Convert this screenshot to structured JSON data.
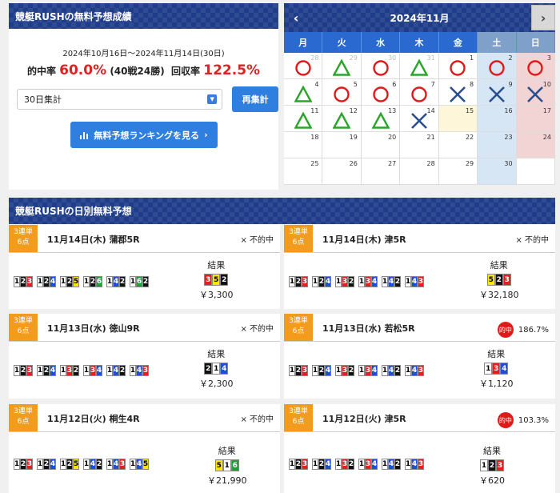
{
  "performance": {
    "title": "競艇RUSHの無料予想成績",
    "period": "2024年10月16日～2024年11月14日(30日)",
    "hit_label": "的中率",
    "hit_rate": "60.0%",
    "record": "(40戦24勝)",
    "return_label": "回収率",
    "return_rate": "122.5%",
    "select_value": "30日集計",
    "recalc_button": "再集計",
    "ranking_button": "無料予想ランキングを見る"
  },
  "calendar": {
    "month_title": "2024年11月",
    "prev": "‹",
    "next": "›",
    "weekdays": [
      "月",
      "火",
      "水",
      "木",
      "金",
      "土",
      "日"
    ],
    "days": [
      {
        "d": "28",
        "m": "circle",
        "other": true
      },
      {
        "d": "29",
        "m": "triangle",
        "other": true
      },
      {
        "d": "30",
        "m": "circle",
        "other": true
      },
      {
        "d": "31",
        "m": "triangle",
        "other": true
      },
      {
        "d": "1",
        "m": "circle"
      },
      {
        "d": "2",
        "m": "circle"
      },
      {
        "d": "3",
        "m": "circle"
      },
      {
        "d": "4",
        "m": "triangle"
      },
      {
        "d": "5",
        "m": "circle"
      },
      {
        "d": "6",
        "m": "circle"
      },
      {
        "d": "7",
        "m": "circle"
      },
      {
        "d": "8",
        "m": "cross"
      },
      {
        "d": "9",
        "m": "cross"
      },
      {
        "d": "10",
        "m": "cross"
      },
      {
        "d": "11",
        "m": "triangle"
      },
      {
        "d": "12",
        "m": "triangle"
      },
      {
        "d": "13",
        "m": "triangle"
      },
      {
        "d": "14",
        "m": "cross"
      },
      {
        "d": "15",
        "m": ""
      },
      {
        "d": "16",
        "m": ""
      },
      {
        "d": "17",
        "m": ""
      },
      {
        "d": "18",
        "m": ""
      },
      {
        "d": "19",
        "m": ""
      },
      {
        "d": "20",
        "m": ""
      },
      {
        "d": "21",
        "m": ""
      },
      {
        "d": "22",
        "m": ""
      },
      {
        "d": "23",
        "m": ""
      },
      {
        "d": "24",
        "m": ""
      },
      {
        "d": "25",
        "m": ""
      },
      {
        "d": "26",
        "m": ""
      },
      {
        "d": "27",
        "m": ""
      },
      {
        "d": "28",
        "m": ""
      },
      {
        "d": "29",
        "m": ""
      },
      {
        "d": "30",
        "m": ""
      },
      {
        "d": "",
        "m": ""
      }
    ]
  },
  "daily": {
    "title": "競艇RUSHの日別無料予想",
    "tag_line1": "3連単",
    "tag_line2": "6点",
    "result_label": "結果",
    "cards": [
      {
        "title": "11月14日(木) 蒲郡5R",
        "badge": "",
        "status": "× 不的中",
        "bets": [
          "123",
          "124",
          "125",
          "126",
          "142",
          "162"
        ],
        "result": "352",
        "payout": "￥3,300"
      },
      {
        "title": "11月14日(木) 津5R",
        "badge": "",
        "status": "× 不的中",
        "bets": [
          "123",
          "124",
          "132",
          "134",
          "142",
          "143"
        ],
        "result": "523",
        "payout": "￥32,180"
      },
      {
        "title": "11月13日(水) 徳山9R",
        "badge": "",
        "status": "× 不的中",
        "bets": [
          "123",
          "124",
          "132",
          "134",
          "142",
          "143"
        ],
        "result": "214",
        "payout": "￥2,300"
      },
      {
        "title": "11月13日(水) 若松5R",
        "badge": "的中",
        "status": "186.7%",
        "bets": [
          "123",
          "124",
          "132",
          "134",
          "142",
          "143"
        ],
        "result": "134",
        "payout": "￥1,120"
      },
      {
        "title": "11月12日(火) 桐生4R",
        "badge": "",
        "status": "× 不的中",
        "bets": [
          "123",
          "124",
          "125",
          "142",
          "143",
          "145"
        ],
        "result": "516",
        "payout": "￥21,990"
      },
      {
        "title": "11月12日(火) 津5R",
        "badge": "的中",
        "status": "103.3%",
        "bets": [
          "123",
          "124",
          "132",
          "134",
          "142",
          "143"
        ],
        "result": "123",
        "payout": "￥620"
      }
    ]
  },
  "colors": {
    "circle": "#e01a1a",
    "triangle": "#2aa52a",
    "cross": "#2a4f8f",
    "accent": "#2f7fe0",
    "tag": "#f39c1c"
  }
}
